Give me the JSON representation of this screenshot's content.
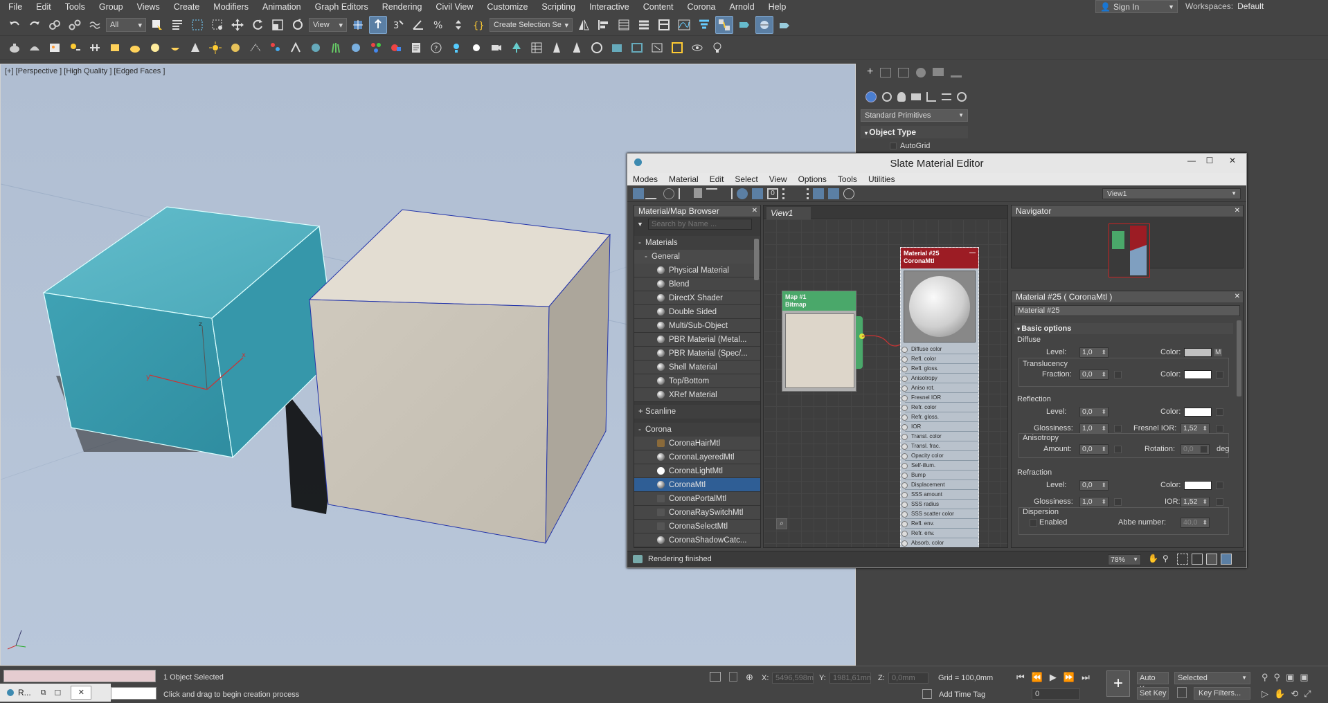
{
  "menu": [
    "File",
    "Edit",
    "Tools",
    "Group",
    "Views",
    "Create",
    "Modifiers",
    "Animation",
    "Graph Editors",
    "Rendering",
    "Civil View",
    "Customize",
    "Scripting",
    "Interactive",
    "Content",
    "Corona",
    "Arnold",
    "Help"
  ],
  "signin": "Sign In",
  "workspace": {
    "label": "Workspaces:",
    "value": "Default"
  },
  "toolbar": {
    "filter": "All",
    "ref_coord": "View",
    "selection_set": "Create Selection Se"
  },
  "viewport": {
    "label": "[+] [Perspective ] [High Quality ] [Edged Faces ]",
    "gizmo": {
      "x": "x",
      "y": "y",
      "z": "z"
    }
  },
  "cmd": {
    "dropdown": "Standard Primitives",
    "rollout": "Object Type",
    "autogrid": "AutoGrid"
  },
  "slate": {
    "title": "Slate Material Editor",
    "menu": [
      "Modes",
      "Material",
      "Edit",
      "Select",
      "View",
      "Options",
      "Tools",
      "Utilities"
    ],
    "view_dropdown": "View1",
    "browser": {
      "title": "Material/Map Browser",
      "search": "Search by Name ...",
      "root": "Materials",
      "general": {
        "label": "General",
        "items": [
          "Physical Material",
          "Blend",
          "DirectX Shader",
          "Double Sided",
          "Multi/Sub-Object",
          "PBR Material (Metal...",
          "PBR Material (Spec/...",
          "Shell Material",
          "Top/Bottom",
          "XRef Material"
        ]
      },
      "scanline": "Scanline",
      "corona": {
        "label": "Corona",
        "items": [
          "CoronaHairMtl",
          "CoronaLayeredMtl",
          "CoronaLightMtl",
          "CoronaMtl",
          "CoronaPortalMtl",
          "CoronaRaySwitchMtl",
          "CoronaSelectMtl",
          "CoronaShadowCatc..."
        ]
      }
    },
    "view_tab": "View1",
    "map_node": {
      "line1": "Map #1",
      "line2": "Bitmap"
    },
    "mat_node": {
      "line1": "Material #25",
      "line2": "CoronaMtl",
      "slots": [
        "Diffuse color",
        "Refl. color",
        "Refl. gloss.",
        "Anisotropy",
        "Aniso rot.",
        "Fresnel IOR",
        "Refr. color",
        "Refr. gloss.",
        "IOR",
        "Transl. color",
        "Transl. frac.",
        "Opacity color",
        "Self-illum.",
        "Bump",
        "Displacement",
        "SSS amount",
        "SSS radius",
        "SSS scatter color",
        "Refl. env.",
        "Refr. env.",
        "Absorb. color"
      ]
    },
    "navigator": "Navigator",
    "params": {
      "title": "Material #25  ( CoronaMtl )",
      "name": "Material #25",
      "rollout": "Basic options",
      "diffuse": {
        "label": "Diffuse",
        "level_label": "Level:",
        "level": "1,0",
        "color_label": "Color:",
        "m": "M",
        "transl_label": "Translucency",
        "fraction_label": "Fraction:",
        "fraction": "0,0",
        "color2_label": "Color:"
      },
      "reflection": {
        "label": "Reflection",
        "level_label": "Level:",
        "level": "0,0",
        "color_label": "Color:",
        "gloss_label": "Glossiness:",
        "gloss": "1,0",
        "fresnel_label": "Fresnel IOR:",
        "fresnel": "1,52",
        "aniso_label": "Anisotropy",
        "amount_label": "Amount:",
        "amount": "0,0",
        "rot_label": "Rotation:",
        "rot": "0,0",
        "deg": "deg"
      },
      "refraction": {
        "label": "Refraction",
        "level_label": "Level:",
        "level": "0,0",
        "color_label": "Color:",
        "gloss_label": "Glossiness:",
        "gloss": "1,0",
        "ior_label": "IOR:",
        "ior": "1,52",
        "disp_label": "Dispersion",
        "enabled": "Enabled",
        "abbe_label": "Abbe number:",
        "abbe": "40,0"
      }
    },
    "status": "Rendering finished",
    "zoom": "78%"
  },
  "status": {
    "selected": "1 Object Selected",
    "prompt": "Click and drag to begin creation process",
    "x_label": "X:",
    "x": "5496,598m",
    "y_label": "Y:",
    "y": "1981,61mn",
    "z_label": "Z:",
    "z": "0,0mm",
    "grid": "Grid = 100,0mm",
    "add_time_tag": "Add Time Tag",
    "auto_key": "Auto K...",
    "set_key": "Set Key",
    "selected_dd": "Selected",
    "key_filters": "Key Filters...",
    "frame": "0",
    "script_tab": "R..."
  },
  "colors": {
    "cyan_box": "#4fb4c5",
    "stone": "#d6d0c4",
    "material_header": "#9c1c24",
    "map_header": "#4aa86a",
    "selection": "#2f5e95"
  }
}
